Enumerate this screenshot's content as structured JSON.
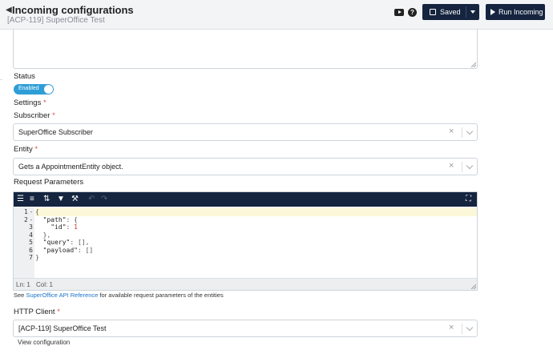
{
  "header": {
    "title": "Incoming configurations",
    "subtitle": "[ACP-119] SuperOffice Test",
    "saved_label": "Saved",
    "run_label": "Run Incoming",
    "help_glyph": "?"
  },
  "form": {
    "status_label": "Status",
    "status_toggle_text": "Enabled",
    "status_enabled": true,
    "settings_label": "Settings",
    "subscriber_label": "Subscriber",
    "subscriber_value": "SuperOffice Subscriber",
    "entity_label": "Entity",
    "entity_value": "Gets a AppointmentEntity object.",
    "request_params_label": "Request Parameters",
    "required_mark": "*",
    "http_client_label": "HTTP Client",
    "http_client_value": "[ACP-119] SuperOffice Test",
    "view_config_link": "View configuration",
    "clear_glyph": "×"
  },
  "editor": {
    "line_numbers": [
      "1",
      "2",
      "3",
      "4",
      "5",
      "6",
      "7"
    ],
    "fold_markers": [
      "-",
      "-"
    ],
    "lines": [
      {
        "parts": [
          {
            "t": "{",
            "c": "p"
          }
        ]
      },
      {
        "parts": [
          {
            "t": "  \"path\"",
            "c": "k"
          },
          {
            "t": ": {",
            "c": "p"
          }
        ]
      },
      {
        "parts": [
          {
            "t": "    \"id\"",
            "c": "k"
          },
          {
            "t": ": ",
            "c": "p"
          },
          {
            "t": "1",
            "c": "n"
          }
        ]
      },
      {
        "parts": [
          {
            "t": "  },",
            "c": "p"
          }
        ]
      },
      {
        "parts": [
          {
            "t": "  \"query\"",
            "c": "k"
          },
          {
            "t": ": [],",
            "c": "p"
          }
        ]
      },
      {
        "parts": [
          {
            "t": "  \"payload\"",
            "c": "k"
          },
          {
            "t": ": []",
            "c": "p"
          }
        ]
      },
      {
        "parts": [
          {
            "t": "}",
            "c": "p"
          }
        ]
      }
    ],
    "status_ln": "Ln: 1",
    "status_col": "Col: 1"
  },
  "help_text": {
    "prefix": "See ",
    "link": "SuperOffice API Reference",
    "suffix": " for available request parameters of the entities"
  },
  "icons": [
    "chevron-left-icon",
    "youtube-icon",
    "help-icon",
    "save-icon",
    "caret-down-icon",
    "play-icon",
    "format-icon",
    "compact-icon",
    "sort-icon",
    "filter-icon",
    "repair-icon",
    "undo-icon",
    "redo-icon",
    "fullscreen-icon",
    "clear-icon",
    "chevron-down-icon"
  ],
  "colors": {
    "primary_dark": "#15243f",
    "toggle_on": "#2f9ed6",
    "link": "#1a73c9",
    "required": "#d9534f"
  }
}
